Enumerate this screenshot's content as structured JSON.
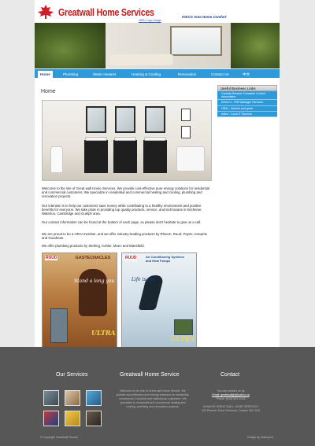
{
  "header": {
    "logo_text": "Greatwall Home Services",
    "tagline": "KWCG Area Home Comfort",
    "sub_link": "HRAI Logo Image"
  },
  "nav": {
    "items": [
      "Home",
      "Plumbing",
      "Water Heaters",
      "Heating & Cooling",
      "Renovation",
      "Contact Us",
      "中文"
    ],
    "active": "Home"
  },
  "main": {
    "title": "Home",
    "paragraphs": [
      "Welcome to the site of Great wall Home Services. We provide cost-effective pure energy solutions for residential and commercial customers. We specialize in residential and commercial heating and cooling, plumbing and renovation projects.",
      "Our intention is to help our customers save money while contributing to a healthy environment and positive benefits for everyone. We take pride in providing top quality products, service, and technicians in Kitchener, Waterloo, Cambridge and Guelph area.",
      "Our contact information can be found at the bottom of each page, so please don't hesitate to give us a call.",
      "We are proud to be a HRAI member, and we offer industry-leading products by Rheem, Ruud, Payne, Keeprite and Goodman.",
      "We offer plumbing products by Sterling, Kohler, Moen and Mansfield."
    ],
    "ads": [
      {
        "brand": "RUUD",
        "headline": "GASTECNACLES",
        "script": "Stand a long you",
        "ultra": "ULTRA"
      },
      {
        "brand": "RUUD",
        "headline": "Air Conditioning Systems and Heat Pumps",
        "script": "Life is fun",
        "ultra": "ULTRA"
      }
    ]
  },
  "sidebar": {
    "title": "Useful Business Links",
    "items": [
      "Canada Greener Canadian Control Association",
      "Direct U - PWI Manager Services",
      "HRAI - Interest and grant",
      "Index - Local IT Sources"
    ]
  },
  "footer": {
    "services_title": "Our Services",
    "about_title": "Greatwall Home Service",
    "about_text": "Welcome to the site of Great wall Home Service. We provide cost-effective pure energy solutions for residential, commercial, industrial and institutional customers. We specialize in residential and commercial heating and cooling, plumbing and renovation projects.",
    "contact_title": "Contact",
    "contact_lines": [
      "You can contact us by",
      "Email: greatwallgh@yahoo.ca",
      "Phone: (519) 591-1245",
      "",
      "KWAKHE GREAT WALL HOME SERVICES",
      "100 Phoenix Drive Kitchener, Ontario N2L 3C5"
    ],
    "contact_email": "greatwallgh@yahoo.ca",
    "copyright": "© Copyright Greatwall Service",
    "design": "Design by sitebuy.ca"
  }
}
